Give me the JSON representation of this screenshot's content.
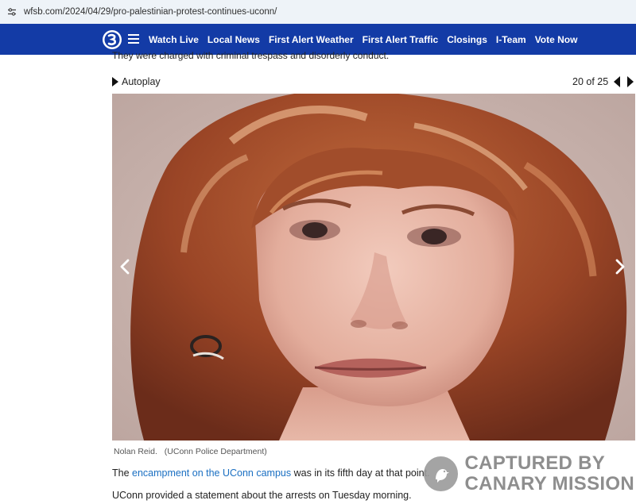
{
  "browser": {
    "url": "wfsb.com/2024/04/29/pro-palestinian-protest-continues-uconn/"
  },
  "nav": {
    "logo_icon": "channel-3-logo",
    "items": [
      {
        "label": "Watch Live"
      },
      {
        "label": "Local News"
      },
      {
        "label": "First Alert Weather"
      },
      {
        "label": "First Alert Traffic"
      },
      {
        "label": "Closings"
      },
      {
        "label": "I-Team"
      },
      {
        "label": "Vote Now"
      }
    ]
  },
  "article": {
    "cut_line": "They were charged with criminal trespass and disorderly conduct.",
    "paragraph1": {
      "before": "The ",
      "link": "encampment on the UConn campus",
      "after": " was in its fifth day at that point."
    },
    "paragraph2": "UConn provided a statement about the arrests on Tuesday morning."
  },
  "gallery": {
    "autoplay_label": "Autoplay",
    "counter": "20 of 25",
    "caption_name": "Nolan Reid.",
    "caption_credit": "(UConn Police Department)"
  },
  "watermark": {
    "line1": "CAPTURED BY",
    "line2": "CANARY MISSION"
  },
  "colors": {
    "nav_bg": "#133ba6",
    "link": "#1a6fc2"
  }
}
